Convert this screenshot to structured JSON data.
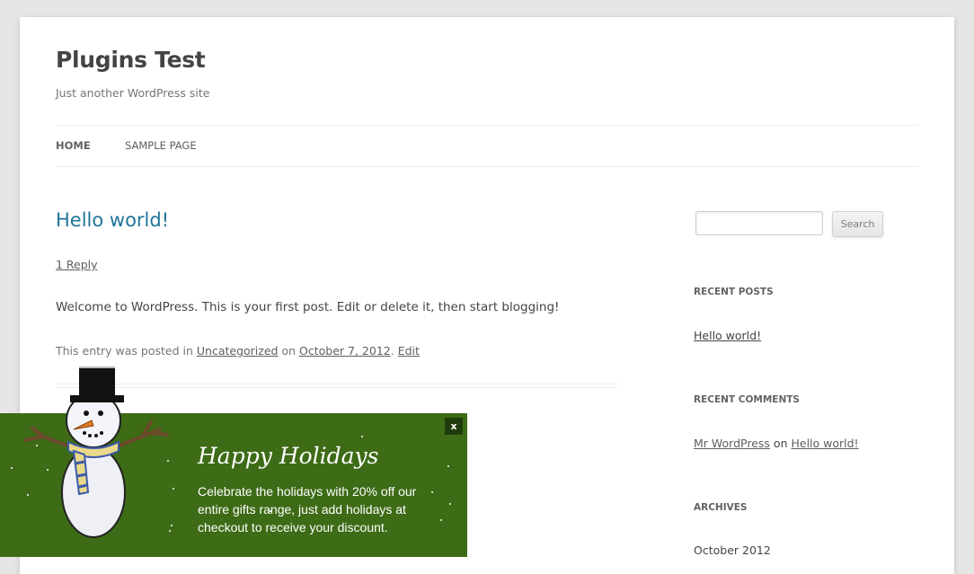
{
  "site": {
    "title": "Plugins Test",
    "description": "Just another WordPress site"
  },
  "nav": {
    "items": [
      {
        "label": "Home",
        "current": true
      },
      {
        "label": "Sample Page",
        "current": false
      }
    ]
  },
  "post": {
    "title": "Hello world!",
    "reply_link": "1 Reply",
    "body": "Welcome to WordPress. This is your first post. Edit or delete it, then start blogging!",
    "meta": {
      "prefix": "This entry was posted in",
      "category": "Uncategorized",
      "on": "on",
      "date": "October 7, 2012",
      "separator": ".",
      "edit": "Edit"
    }
  },
  "sidebar": {
    "search_button": "Search",
    "search_value": "",
    "recent_posts_title": "Recent Posts",
    "recent_posts": [
      "Hello world!"
    ],
    "recent_comments_title": "Recent Comments",
    "recent_comment": {
      "author": "Mr WordPress",
      "on": "on",
      "post": "Hello world!"
    },
    "archives_title": "Archives",
    "archives": [
      "October 2012"
    ]
  },
  "popup": {
    "close_label": "x",
    "title": "Happy Holidays",
    "text": "Celebrate the holidays with 20% off our entire gifts range, just add holidays at checkout to receive your discount.",
    "background_color": "#3d6b16",
    "icon": "snowman-illustration"
  },
  "colors": {
    "link_blue": "#21759b",
    "page_bg": "#e6e6e6"
  }
}
